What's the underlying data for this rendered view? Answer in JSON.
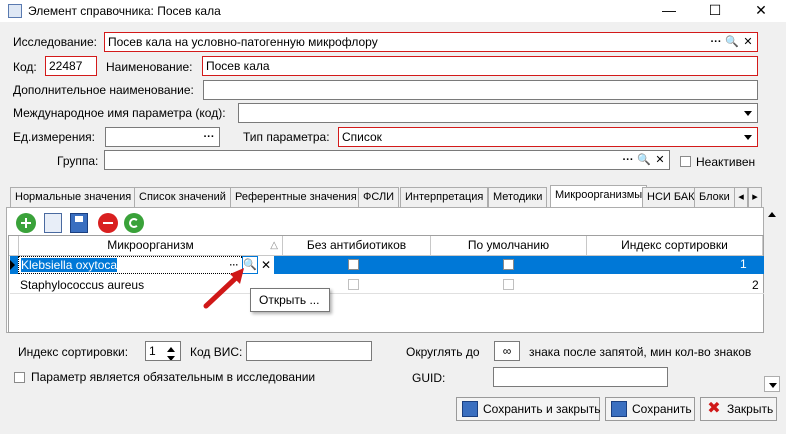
{
  "window": {
    "title": "Элемент справочника: Посев кала"
  },
  "form": {
    "research_label": "Исследование:",
    "research_value": "Посев кала на условно-патогенную микрофлору",
    "code_label": "Код:",
    "code_value": "22487",
    "name_label": "Наименование:",
    "name_value": "Посев кала",
    "addname_label": "Дополнительное наименование:",
    "addname_value": "",
    "intl_label": "Международное имя параметра (код):",
    "intl_value": "",
    "unit_label": "Ед.измерения:",
    "unit_value": "",
    "type_label": "Тип параметра:",
    "type_value": "Список",
    "group_label": "Группа:",
    "group_value": "",
    "inactive_label": "Неактивен"
  },
  "tabs": [
    "Нормальные значения",
    "Список значений",
    "Референтные значения",
    "ФСЛИ",
    "Интерпретация",
    "Методики",
    "Микроорганизмы",
    "НСИ БАК",
    "Блоки"
  ],
  "grid": {
    "columns": [
      "Микроорганизм",
      "Без антибиотиков",
      "По умолчанию",
      "Индекс сортировки"
    ],
    "rows": [
      {
        "organism": "Klebsiella oxytoca",
        "sort_index": "1"
      },
      {
        "organism": "Staphylococcus aureus",
        "sort_index": "2"
      }
    ]
  },
  "tooltip": "Открыть ...",
  "bottom": {
    "sort_label": "Индекс сортировки:",
    "sort_value": "1",
    "vis_label": "Код ВИС:",
    "vis_value": "",
    "round_label": "Округлять до",
    "round_value": "∞",
    "round_suffix": "знака после запятой, мин кол-во знаков",
    "required_label": "Параметр является обязательным в исследовании",
    "guid_label": "GUID:",
    "guid_value": ""
  },
  "buttons": {
    "save_close": "Сохранить и закрыть",
    "save": "Сохранить",
    "close": "Закрыть"
  },
  "colors": {
    "accent": "#0078d7",
    "required_border": "#d31a1a",
    "arrow": "#d01818"
  }
}
